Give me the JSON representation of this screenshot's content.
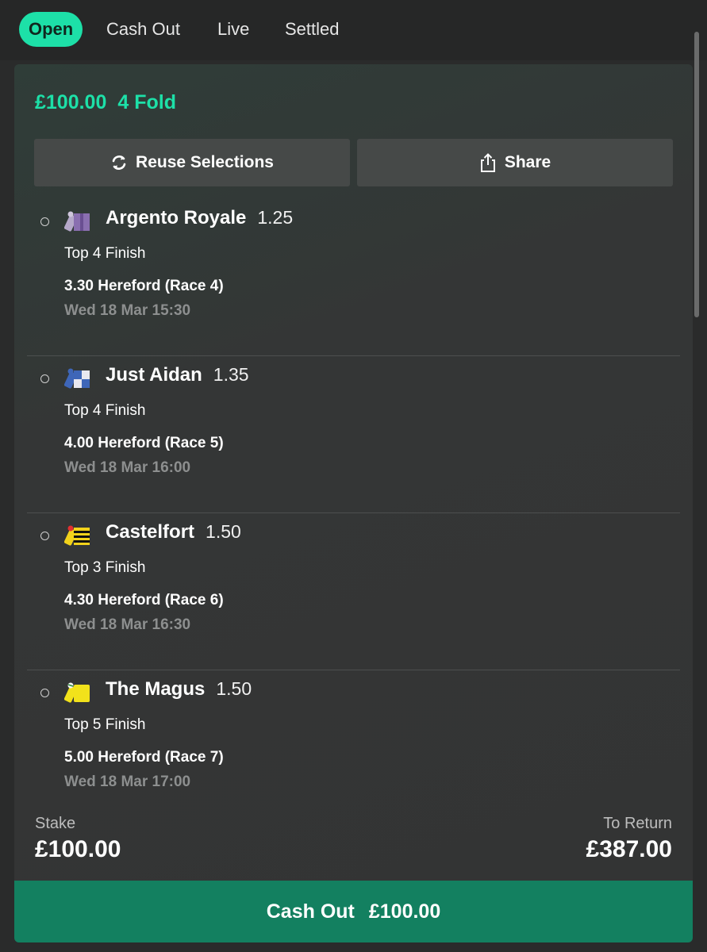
{
  "tabs": [
    {
      "label": "Open",
      "active": true
    },
    {
      "label": "Cash Out",
      "active": false
    },
    {
      "label": "Live",
      "active": false
    },
    {
      "label": "Settled",
      "active": false
    }
  ],
  "bet": {
    "stake_header": "£100.00",
    "type": "4 Fold",
    "reuse_label": "Reuse Selections",
    "share_label": "Share",
    "stake_label": "Stake",
    "stake_value": "£100.00",
    "return_label": "To Return",
    "return_value": "£387.00",
    "cashout_label": "Cash Out",
    "cashout_value": "£100.00"
  },
  "selections": [
    {
      "name": "Argento Royale",
      "odds": "1.25",
      "market": "Top 4 Finish",
      "event": "3.30 Hereford (Race 4)",
      "time": "Wed 18 Mar 15:30",
      "silk": "purple-silk-icon"
    },
    {
      "name": "Just Aidan",
      "odds": "1.35",
      "market": "Top 4 Finish",
      "event": "4.00 Hereford (Race 5)",
      "time": "Wed 18 Mar 16:00",
      "silk": "blue-white-check-silk-icon"
    },
    {
      "name": "Castelfort",
      "odds": "1.50",
      "market": "Top 3 Finish",
      "event": "4.30 Hereford (Race 6)",
      "time": "Wed 18 Mar 16:30",
      "silk": "yellow-black-hoops-silk-icon"
    },
    {
      "name": "The Magus",
      "odds": "1.50",
      "market": "Top 5 Finish",
      "event": "5.00 Hereford (Race 7)",
      "time": "Wed 18 Mar 17:00",
      "silk": "yellow-silk-icon"
    }
  ],
  "colors": {
    "accent": "#1de0a8",
    "cashout": "#138060",
    "card": "#333434"
  }
}
